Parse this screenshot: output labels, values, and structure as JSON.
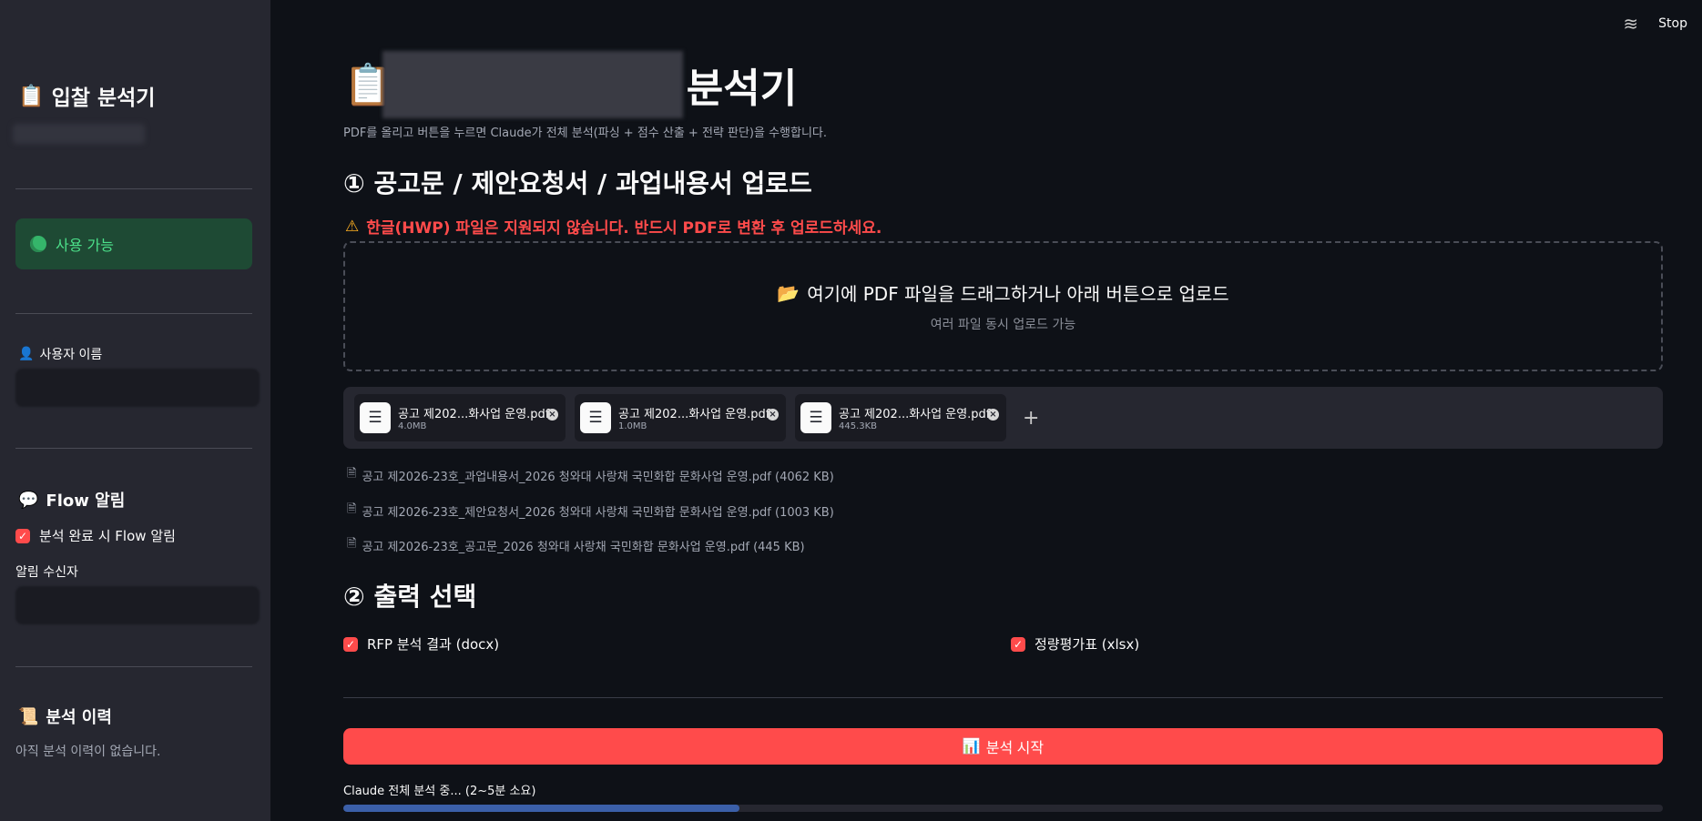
{
  "sidebar": {
    "title": "입찰 분석기",
    "title_icon": "clipboard-icon",
    "status_text": "사용 가능",
    "user_label": "사용자 이름",
    "flow_heading": "Flow 알림",
    "flow_checkbox_label": "분석 완료 시 Flow 알림",
    "flow_checked": true,
    "recipient_label": "알림 수신자",
    "history_heading": "분석 이력",
    "history_empty": "아직 분석 이력이 없습니다."
  },
  "header": {
    "stop_label": "Stop"
  },
  "main": {
    "title_suffix": "분석기",
    "subtitle": "PDF를 올리고 버튼을 누르면 Claude가 전체 분석(파싱 + 점수 산출 + 전략 판단)을 수행합니다.",
    "section1_title": "① 공고문 / 제안요청서 / 과업내용서 업로드",
    "warning": "한글(HWP) 파일은 지원되지 않습니다. 반드시 PDF로 변환 후 업로드하세요.",
    "dropzone_main": "여기에 PDF 파일을 드래그하거나 아래 버튼으로 업로드",
    "dropzone_sub": "여러 파일 동시 업로드 가능",
    "chips": [
      {
        "name": "공고 제202...화사업 운영.pdf",
        "size": "4.0MB"
      },
      {
        "name": "공고 제202...화사업 운영.pdf",
        "size": "1.0MB"
      },
      {
        "name": "공고 제202...화사업 운영.pdf",
        "size": "445.3KB"
      }
    ],
    "add_label": "+",
    "files": [
      "공고 제2026-23호_과업내용서_2026 청와대 사랑채 국민화합 문화사업 운영.pdf (4062 KB)",
      "공고 제2026-23호_제안요청서_2026 청와대 사랑채 국민화합 문화사업 운영.pdf (1003 KB)",
      "공고 제2026-23호_공고문_2026 청와대 사랑채 국민화합 문화사업 운영.pdf (445 KB)"
    ],
    "section2_title": "② 출력 선택",
    "option_rfp": "RFP 분석 결과 (docx)",
    "option_rfp_checked": true,
    "option_quant": "정량평가표 (xlsx)",
    "option_quant_checked": true,
    "start_button": "분석 시작",
    "progress_label": "Claude 전체 분석 중... (2~5분 소요)",
    "progress_fraction": 0.3
  }
}
